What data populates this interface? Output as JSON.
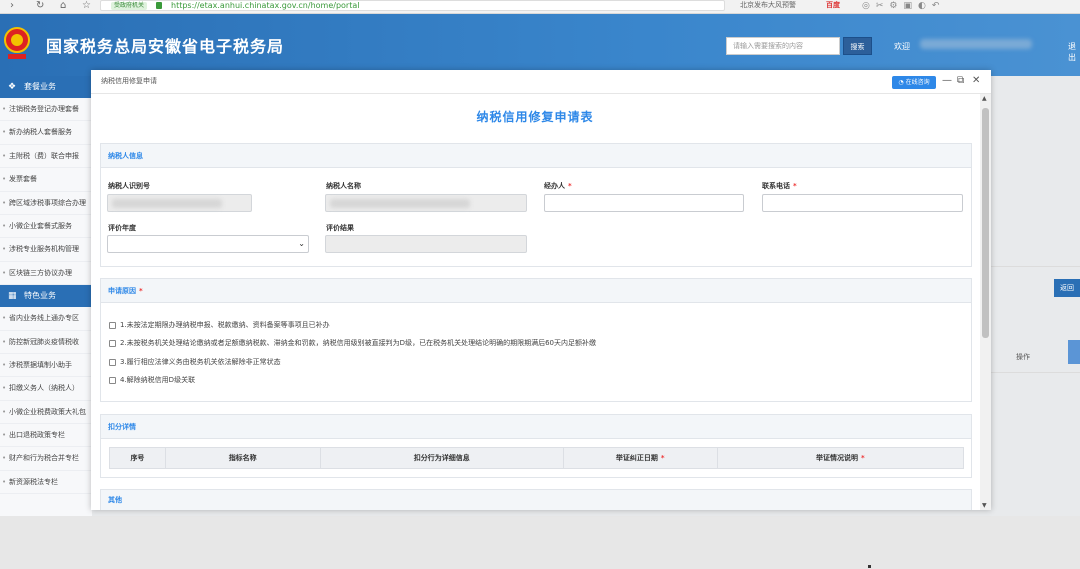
{
  "browser": {
    "url_badge": "受政府机关",
    "url": "https://etax.anhui.chinatax.gov.cn/home/portal",
    "search_hint": "北京发布大风预警",
    "search_engine": "百度"
  },
  "site": {
    "title": "国家税务总局安徽省电子税务局",
    "search_placeholder": "请输入需要搜索的内容",
    "search_button": "搜索",
    "welcome": "欢迎",
    "welcome_tail": "退出"
  },
  "sidebar": {
    "section1": "套餐业务",
    "items1": [
      "注销税务登记办理套餐",
      "新办纳税人套餐服务",
      "主附税（费）联合申报",
      "发票套餐",
      "跨区域涉税事项综合办理",
      "小微企业套餐式服务",
      "涉税专业服务机构管理",
      "区块链三方协议办理"
    ],
    "section2": "特色业务",
    "items2": [
      "省内业务线上通办专区",
      "防控新冠肺炎疫情税收",
      "涉税票据填制小助手",
      "扣缴义务人（纳税人）",
      "小微企业税费政策大礼包",
      "出口退税政策专栏",
      "财产和行为税合并专栏",
      "新资源税法专栏"
    ]
  },
  "background": {
    "back_button": "返回",
    "op_column": "操作"
  },
  "modal": {
    "title": "纳税信用修复申请",
    "online_button": "在线咨询",
    "heading": "纳税信用修复申请表",
    "taxpayer_section": "纳税人信息",
    "fields": {
      "taxpayer_id_label": "纳税人识别号",
      "taxpayer_name_label": "纳税人名称",
      "handler_label": "经办人",
      "phone_label": "联系电话",
      "year_label": "评价年度",
      "result_label": "评价结果"
    },
    "required_mark": "*",
    "reason_section": "申请原因",
    "reasons": [
      "1.未按法定期限办理纳税申报、税款缴纳、资料备案等事项且已补办",
      "2.未按税务机关处理结论缴纳或者足额缴纳税款、滞纳金和罚款，纳税信用级别被直接判为D级，已在税务机关处理结论明确的期限期满后60天内足额补缴",
      "3.履行相应法律义务由税务机关依法解除非正常状态",
      "4.解除纳税信用D级关联"
    ],
    "deduction_section": "扣分详情",
    "table_headers": [
      "序号",
      "指标名称",
      "扣分行为详细信息",
      "举证纠正日期",
      "举证情况说明"
    ],
    "table_required": [
      false,
      false,
      false,
      true,
      true
    ],
    "other_section": "其他"
  },
  "colors": {
    "header_blue": "#2a6fb5",
    "accent": "#2e88e8",
    "required_red": "#e33333"
  }
}
